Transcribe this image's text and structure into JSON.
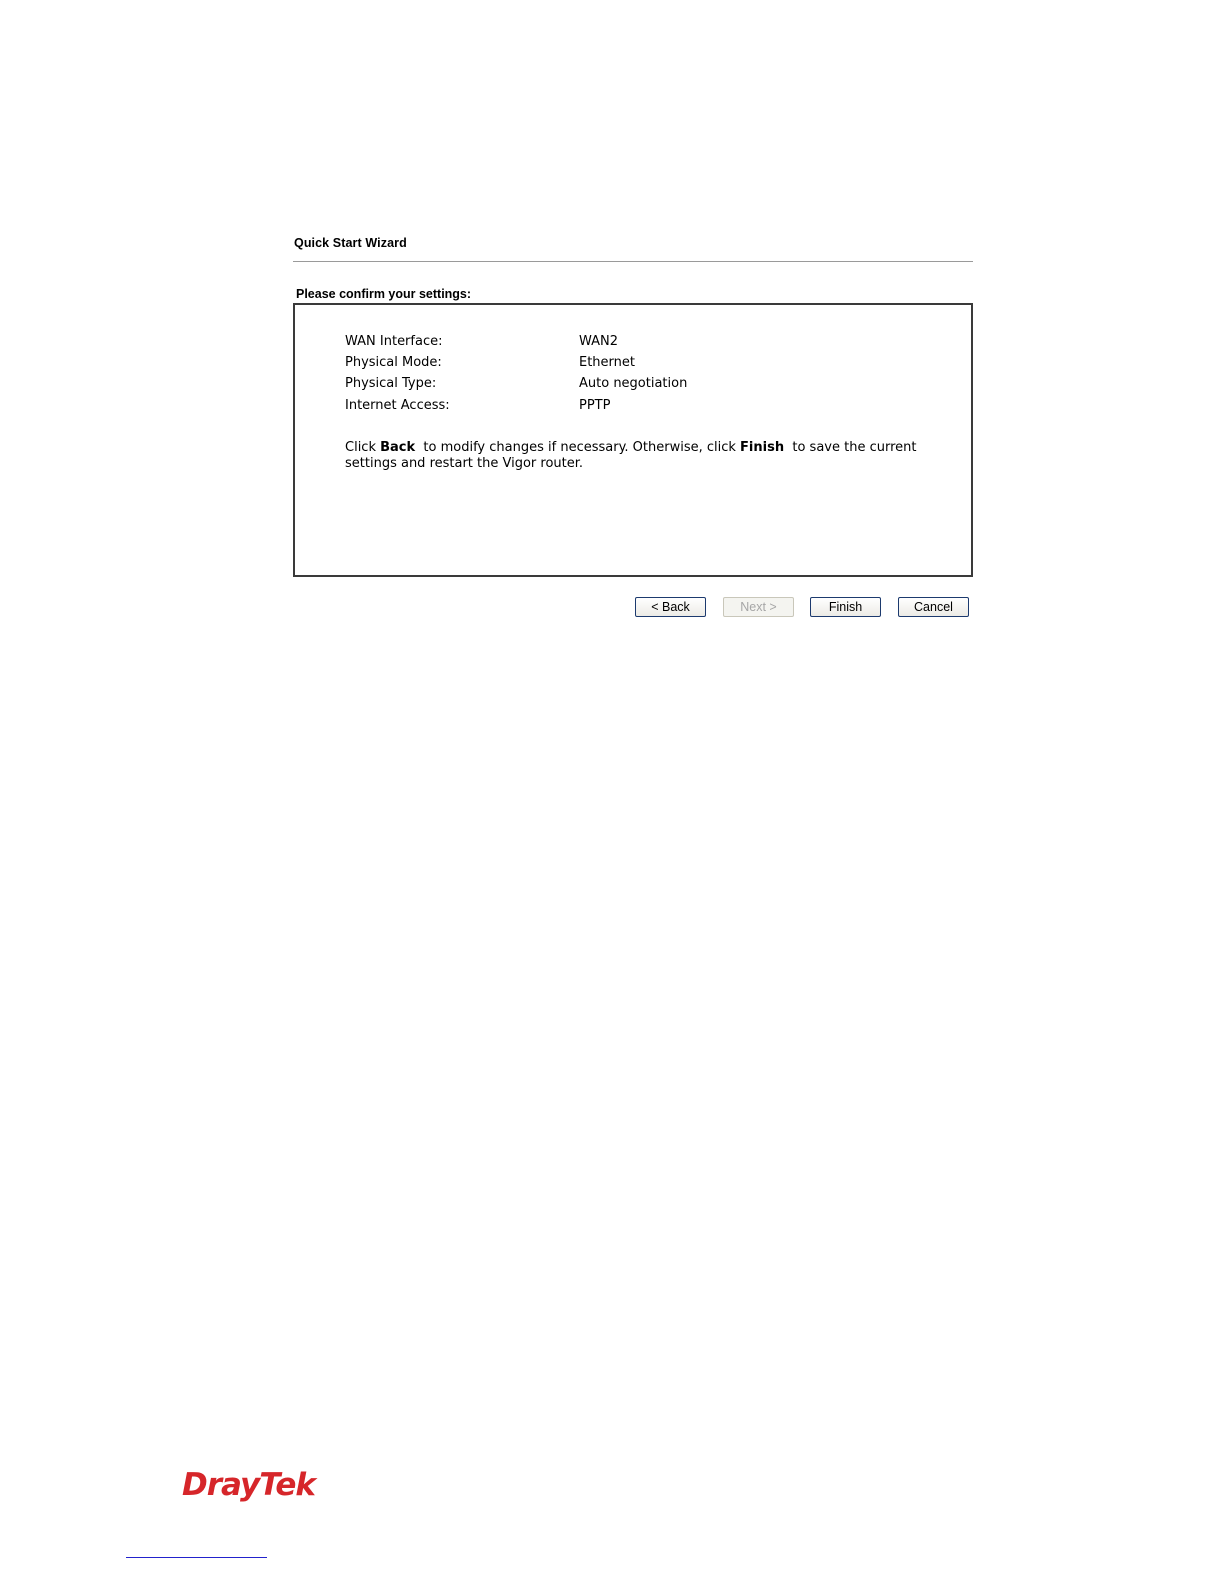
{
  "wizard": {
    "title": "Quick Start Wizard",
    "heading": "Please confirm your settings:"
  },
  "settings": [
    {
      "label": "WAN Interface:",
      "value": "WAN2"
    },
    {
      "label": "Physical Mode:",
      "value": "Ethernet"
    },
    {
      "label": "Physical Type:",
      "value": "Auto negotiation"
    },
    {
      "label": "Internet Access:",
      "value": "PPTP"
    }
  ],
  "message": {
    "part1": "Click ",
    "back_word": "Back",
    "part2": "  to modify changes if necessary. Otherwise, click ",
    "finish_word": "Finish",
    "part3": "  to save the current settings and restart the Vigor router."
  },
  "buttons": {
    "back": "< Back",
    "next": "Next >",
    "finish": "Finish",
    "cancel": "Cancel",
    "next_disabled": true
  },
  "footer": {
    "logo_text": "DrayTek",
    "brand_color": "#d6262a"
  }
}
